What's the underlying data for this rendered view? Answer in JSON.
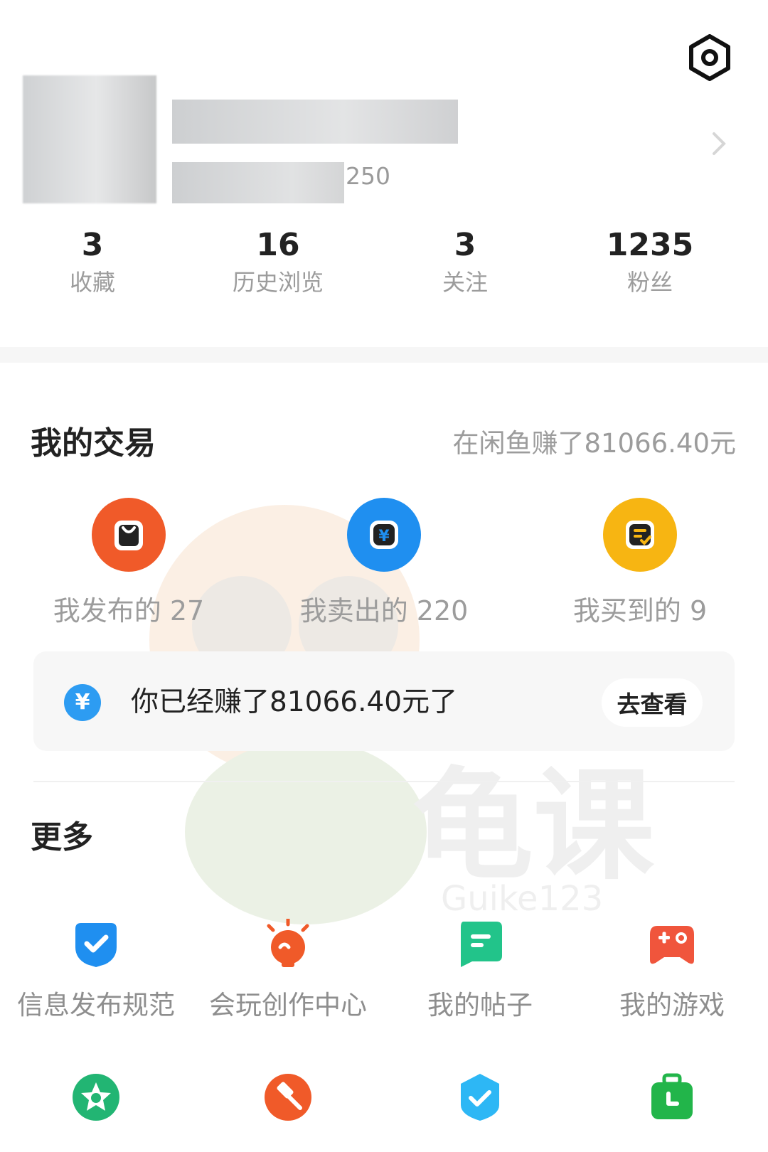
{
  "header": {
    "settings_icon": "settings-hexagon-icon",
    "level_number": "250",
    "chevron_icon": "chevron-right-icon"
  },
  "stats": [
    {
      "value": "3",
      "label": "收藏"
    },
    {
      "value": "16",
      "label": "历史浏览"
    },
    {
      "value": "3",
      "label": "关注"
    },
    {
      "value": "1235",
      "label": "粉丝"
    }
  ],
  "trade": {
    "title": "我的交易",
    "summary": "在闲鱼赚了81066.40元",
    "items": [
      {
        "label": "我发布的 27",
        "icon": "bag-icon",
        "color": "#f05a29"
      },
      {
        "label": "我卖出的 220",
        "icon": "yuan-icon",
        "color": "#1f8ff0"
      },
      {
        "label": "我买到的 9",
        "icon": "order-check-icon",
        "color": "#f7b512"
      }
    ],
    "banner": {
      "text": "你已经赚了81066.40元了",
      "button": "去查看",
      "icon": "yuan-coin-icon"
    }
  },
  "more": {
    "title": "更多",
    "items": [
      {
        "label": "信息发布规范",
        "icon": "check-shield-icon",
        "color": "#1f8ff0"
      },
      {
        "label": "会玩创作中心",
        "icon": "lightbulb-icon",
        "color": "#f05a29"
      },
      {
        "label": "我的帖子",
        "icon": "post-icon",
        "color": "#22c48a"
      },
      {
        "label": "我的游戏",
        "icon": "gamepad-icon",
        "color": "#f0553c"
      }
    ],
    "row2_icons": [
      {
        "icon": "star-badge-icon",
        "color": "#22b573"
      },
      {
        "icon": "auction-hammer-icon",
        "color": "#f05a29"
      },
      {
        "icon": "verified-icon",
        "color": "#2db7f5"
      },
      {
        "icon": "briefcase-clock-icon",
        "color": "#22b54a"
      }
    ]
  },
  "watermark": {
    "brand": "龟课",
    "site": "Guike123"
  }
}
